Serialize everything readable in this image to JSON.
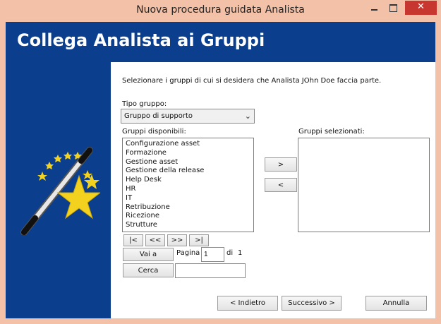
{
  "window": {
    "title": "Nuova procedura guidata Analista"
  },
  "header": {
    "title": "Collega Analista ai Gruppi"
  },
  "panel": {
    "instruction": "Selezionare i gruppi di cui si desidera che Analista JOhn Doe faccia parte.",
    "group_type_label": "Tipo gruppo:",
    "group_type_value": "Gruppo di supporto",
    "available_label": "Gruppi disponibili:",
    "selected_label": "Gruppi selezionati:",
    "available_groups": [
      "Configurazione asset",
      "Formazione",
      "Gestione asset",
      "Gestione della release",
      "Help Desk",
      "HR",
      "IT",
      "Retribuzione",
      "Ricezione",
      "Strutture"
    ],
    "selected_groups": [],
    "add_button": ">",
    "remove_button": "<",
    "pager": {
      "first": "|<",
      "prev": "<<",
      "next": ">>",
      "last": ">|",
      "goto_button": "Vai a",
      "page_label": "Pagina",
      "page_value": "1",
      "of_label": "di",
      "total_pages": "1"
    },
    "search_button": "Cerca",
    "search_value": ""
  },
  "footer": {
    "back": "< Indietro",
    "next": "Successivo >",
    "cancel": "Annulla"
  },
  "colors": {
    "titlebar": "#f2c1a8",
    "banner": "#0b3f8e",
    "close": "#c7372f"
  },
  "icons": [
    "minimize-icon",
    "maximize-icon",
    "close-icon",
    "magic-wand-icon",
    "dropdown-caret-icon"
  ]
}
